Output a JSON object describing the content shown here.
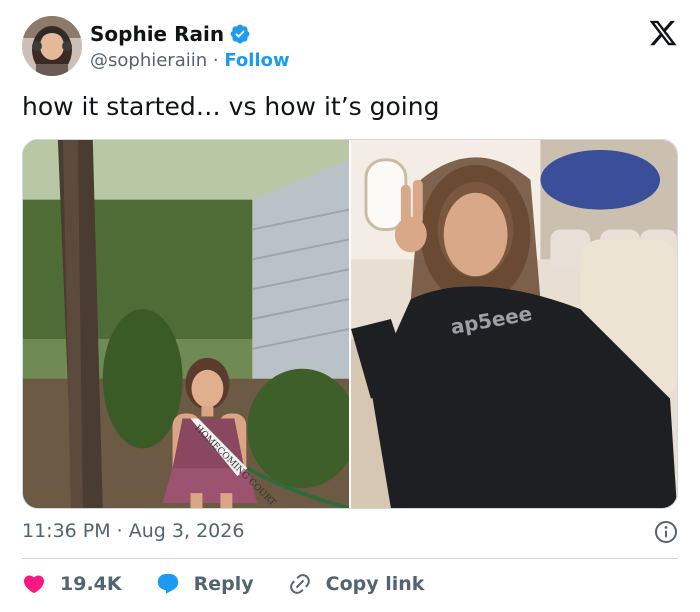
{
  "author": {
    "display_name": "Sophie Rain",
    "handle": "@sophieraiin",
    "separator": " · ",
    "follow_label": "Follow"
  },
  "tweet": {
    "text": "how it started… vs how it’s going",
    "timestamp": "11:36 PM · Aug 3, 2026"
  },
  "media": {
    "left_photo_sash_text": "HOMECOMING COURT",
    "right_photo_hoodie_text": "ap5eee"
  },
  "actions": {
    "like_count": "19.4K",
    "reply_label": "Reply",
    "copy_label": "Copy link"
  },
  "colors": {
    "accent": "#1d9bf0",
    "like": "#f91880",
    "text": "#0f1419",
    "secondary": "#536471",
    "border": "#cfd9de"
  },
  "icons": [
    "verified-badge-icon",
    "x-logo-icon",
    "info-icon",
    "heart-icon",
    "reply-bubble-icon",
    "link-icon"
  ]
}
